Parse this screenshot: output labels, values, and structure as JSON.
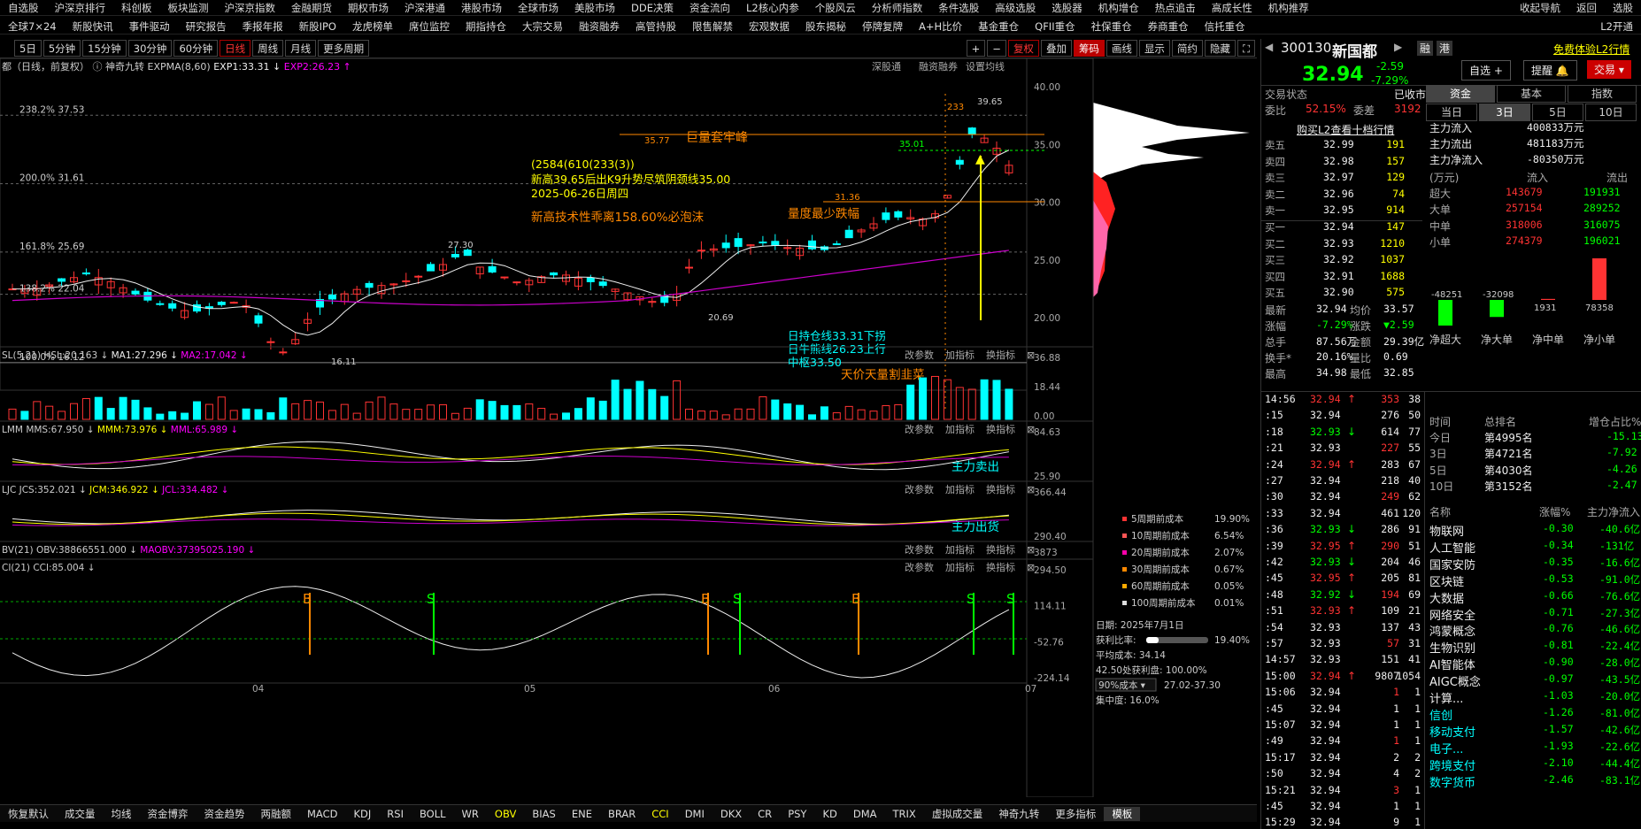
{
  "menu1": [
    "自选股",
    "沪深京排行",
    "科创板",
    "板块监测",
    "沪深京指数",
    "金融期货",
    "期权市场",
    "沪深港通",
    "港股市场",
    "全球市场",
    "美股市场",
    "DDE决策",
    "资金流向",
    "L2核心内参",
    "个股风云",
    "分析师指数",
    "条件选股",
    "高级选股",
    "选股器",
    "机构增仓",
    "热点追击",
    "高成长性",
    "机构推荐"
  ],
  "menu1_right": [
    "收起导航",
    "返回",
    "选股"
  ],
  "menu2": [
    "全球7×24",
    "新股快讯",
    "事件驱动",
    "研究报告",
    "季报年报",
    "新股IPO",
    "龙虎榜单",
    "席位监控",
    "期指持仓",
    "大宗交易",
    "融资融券",
    "高管持股",
    "限售解禁",
    "宏观数据",
    "股东揭秘",
    "停牌复牌",
    "A+H比价",
    "基金重仓",
    "QFII重仓",
    "社保重仓",
    "券商重仓",
    "信托重仓"
  ],
  "menu2_right": "L2开通",
  "toolbar": {
    "periods": [
      "5日",
      "5分钟",
      "15分钟",
      "30分钟",
      "60分钟",
      "日线",
      "周线",
      "月线",
      "更多周期"
    ],
    "selected": "日线",
    "right": [
      "复权",
      "叠加",
      "筹码",
      "画线",
      "显示",
      "简约",
      "隐藏"
    ]
  },
  "chart_header": {
    "name": "都（日线，前复权）",
    "indicator": "神奇九转",
    "expma": "EXPMA(8,60)",
    "exp1": "EXP1:33.31",
    "exp2": "EXP2:26.23",
    "links": [
      "深股通",
      "融资融券",
      "设置均线"
    ]
  },
  "price_axis": [
    "40.00",
    "35.00",
    "30.00",
    "25.00",
    "20.00"
  ],
  "fib_labels": [
    "238.2% 37.53",
    "200.0% 31.61",
    "161.8% 25.69",
    "138.2% 22.04",
    "100.0% 16.12"
  ],
  "annotations": {
    "peak": "39.65",
    "h233": "233",
    "l35_77": "35.77",
    "l35_01": "35.01",
    "l31_36": "31.36",
    "l27_30": "27.30",
    "l16_11": "16.11",
    "l20_69": "20.69",
    "title1": "巨量套牢峰",
    "block1": "(2584(610(233(3))",
    "block2": "新高39.65后出K9升势尽筑阴颈线35.00",
    "block3": "2025-06-26日周四",
    "block4": "新高技术性乖离158.60%必泡沫",
    "block5": "量度最少跌幅",
    "hold1": "日持仓线33.31下拐",
    "hold2": "日牛熊线26.23上行",
    "hold3": "中枢33.50"
  },
  "panels": [
    {
      "title": "SL(5,21)",
      "items": [
        {
          "t": "HSL:20.163",
          "c": "#ccc"
        },
        {
          "t": "MA1:27.296",
          "c": "#eee"
        },
        {
          "t": "MA2:17.042",
          "c": "#f0f"
        }
      ],
      "axis": [
        "36.88",
        "18.44",
        "0.00"
      ],
      "note": "天价天量割韭菜"
    },
    {
      "title": "LMM",
      "items": [
        {
          "t": "MMS:67.950",
          "c": "#ccc"
        },
        {
          "t": "MMM:73.976",
          "c": "#ff0"
        },
        {
          "t": "MML:65.989",
          "c": "#f0f"
        }
      ],
      "axis": [
        "84.63",
        "25.90"
      ],
      "note": "主力卖出"
    },
    {
      "title": "LJC",
      "items": [
        {
          "t": "JCS:352.021",
          "c": "#ccc"
        },
        {
          "t": "JCM:346.922",
          "c": "#ff0"
        },
        {
          "t": "JCL:334.482",
          "c": "#f0f"
        }
      ],
      "axis": [
        "366.44",
        "290.40"
      ],
      "note": "主力出货"
    },
    {
      "title": "BV(21)",
      "items": [
        {
          "t": "OBV:38866551.000",
          "c": "#ccc"
        },
        {
          "t": "MAOBV:37395025.190",
          "c": "#f0f"
        }
      ],
      "axis": [
        "3873"
      ],
      "note": ""
    },
    {
      "title": "CI(21)",
      "items": [
        {
          "t": "CCI:85.004",
          "c": "#ccc"
        }
      ],
      "axis": [
        "294.50",
        "114.11",
        "-52.76",
        "-224.14"
      ],
      "note": ""
    }
  ],
  "panel_btns": [
    "改参数",
    "加指标",
    "换指标"
  ],
  "x_labels": [
    "04",
    "05",
    "06",
    "07"
  ],
  "cost_legend": [
    {
      "label": "5周期前成本",
      "val": "19.90%",
      "c": "#f33"
    },
    {
      "label": "10周期前成本",
      "val": "6.54%",
      "c": "#f55"
    },
    {
      "label": "20周期前成本",
      "val": "2.07%",
      "c": "#f0a"
    },
    {
      "label": "30周期前成本",
      "val": "0.67%",
      "c": "#f80"
    },
    {
      "label": "60周期前成本",
      "val": "0.05%",
      "c": "#fa0"
    },
    {
      "label": "100周期前成本",
      "val": "0.01%",
      "c": "#ddd"
    }
  ],
  "cost_info": {
    "date": "日期: 2025年7月1日",
    "profit_label": "获利比率:",
    "profit": "19.40%",
    "avg": "平均成本: 34.14",
    "profit2": "42.50处获利盘: 100.00%",
    "cost90": "90%成本",
    "range": "27.02-37.30",
    "conc": "集中度: 16.0%"
  },
  "bottom_tabs": [
    "恢复默认",
    "成交量",
    "均线",
    "资金博弈",
    "资金趋势",
    "两融额",
    "MACD",
    "KDJ",
    "RSI",
    "BOLL",
    "WR",
    "OBV",
    "BIAS",
    "ENE",
    "BRAR",
    "CCI",
    "DMI",
    "DKX",
    "CR",
    "PSY",
    "KD",
    "DMA",
    "TRIX",
    "虚拟成交量",
    "神奇九转",
    "更多指标",
    "模板"
  ],
  "bottom_tabs_selected": [
    "OBV",
    "CCI"
  ],
  "stock": {
    "code": "300130",
    "name": "新国都",
    "btn1": "融",
    "btn2": "港",
    "ad": "免费体验L2行情",
    "price": "32.94",
    "chg": "-2.59",
    "pct": "-7.29%",
    "b_self": "自选",
    "b_alert": "提醒",
    "b_trade": "交易"
  },
  "status": {
    "label": "交易状态",
    "val": "已收市",
    "wb_label": "委比",
    "wb": "52.15%",
    "wc_label": "委差",
    "wc": "3192"
  },
  "tabs_top": [
    "资金",
    "基本",
    "指数"
  ],
  "tabs_period": [
    "当日",
    "3日",
    "5日",
    "10日"
  ],
  "l2_link": "购买L2查看十档行情",
  "asks": [
    [
      "卖五",
      "32.99",
      "191"
    ],
    [
      "卖四",
      "32.98",
      "157"
    ],
    [
      "卖三",
      "32.97",
      "129"
    ],
    [
      "卖二",
      "32.96",
      "74"
    ],
    [
      "卖一",
      "32.95",
      "914"
    ]
  ],
  "bids": [
    [
      "买一",
      "32.94",
      "147"
    ],
    [
      "买二",
      "32.93",
      "1210"
    ],
    [
      "买三",
      "32.92",
      "1037"
    ],
    [
      "买四",
      "32.91",
      "1688"
    ],
    [
      "买五",
      "32.90",
      "575"
    ]
  ],
  "stats": [
    [
      "最新",
      "32.94",
      "均价",
      "33.57"
    ],
    [
      "涨幅",
      "-7.29%",
      "涨跌",
      "▼2.59"
    ],
    [
      "总手",
      "87.56万",
      "金额",
      "29.39亿"
    ],
    [
      "换手*",
      "20.16%",
      "量比",
      "0.69"
    ],
    [
      "最高",
      "34.98",
      "最低",
      "32.85"
    ]
  ],
  "flow": [
    [
      "主力流入",
      "400833万元"
    ],
    [
      "主力流出",
      "481183万元"
    ],
    [
      "主力净流入",
      "-80350万元"
    ]
  ],
  "flow_table": {
    "head": [
      "(万元)",
      "流入",
      "流出"
    ],
    "rows": [
      [
        "超大",
        "143679",
        "191931"
      ],
      [
        "大单",
        "257154",
        "289252"
      ],
      [
        "中单",
        "318006",
        "316075"
      ],
      [
        "小单",
        "274379",
        "196021"
      ]
    ]
  },
  "flow_bars": [
    {
      "label": "超大",
      "v": -48251
    },
    {
      "label": "大单",
      "v": -32098
    },
    {
      "label": "中单",
      "v": 1931
    },
    {
      "label": "小单",
      "v": 78358
    }
  ],
  "flow_bar_labels": [
    "-48251",
    "-32098",
    "1931",
    "78358"
  ],
  "flow_bar_cats": [
    "净超大",
    "净大单",
    "净中单",
    "净小单"
  ],
  "ticks": [
    [
      "14:56",
      "32.94",
      "↑",
      "353",
      "38"
    ],
    [
      ":15",
      "32.94",
      "",
      "276",
      "50"
    ],
    [
      ":18",
      "32.93",
      "↓",
      "614",
      "77"
    ],
    [
      ":21",
      "32.93",
      "",
      "227",
      "55"
    ],
    [
      ":24",
      "32.94",
      "↑",
      "283",
      "67"
    ],
    [
      ":27",
      "32.94",
      "",
      "218",
      "40"
    ],
    [
      ":30",
      "32.94",
      "",
      "249",
      "62"
    ],
    [
      ":33",
      "32.94",
      "",
      "461",
      "120"
    ],
    [
      ":36",
      "32.93",
      "↓",
      "286",
      "91"
    ],
    [
      ":39",
      "32.95",
      "↑",
      "290",
      "51"
    ],
    [
      ":42",
      "32.93",
      "↓",
      "204",
      "46"
    ],
    [
      ":45",
      "32.95",
      "↑",
      "205",
      "81"
    ],
    [
      ":48",
      "32.92",
      "↓",
      "194",
      "69"
    ],
    [
      ":51",
      "32.93",
      "↑",
      "109",
      "21"
    ],
    [
      ":54",
      "32.93",
      "",
      "137",
      "43"
    ],
    [
      ":57",
      "32.93",
      "",
      "57",
      "31"
    ],
    [
      "14:57",
      "32.93",
      "",
      "151",
      "41"
    ],
    [
      "15:00",
      "32.94",
      "↑",
      "9807",
      "1054"
    ],
    [
      "15:06",
      "32.94",
      "",
      "1",
      "1"
    ],
    [
      ":45",
      "32.94",
      "",
      "1",
      "1"
    ],
    [
      "15:07",
      "32.94",
      "",
      "1",
      "1"
    ],
    [
      ":49",
      "32.94",
      "",
      "1",
      "1"
    ],
    [
      "15:17",
      "32.94",
      "",
      "2",
      "2"
    ],
    [
      ":50",
      "32.94",
      "",
      "4",
      "2"
    ],
    [
      "15:21",
      "32.94",
      "",
      "3",
      "1"
    ],
    [
      ":45",
      "32.94",
      "",
      "1",
      "1"
    ],
    [
      "15:29",
      "32.94",
      "",
      "9",
      "1"
    ]
  ],
  "rank": {
    "head": [
      "时间",
      "总排名",
      "增仓占比%"
    ],
    "rows": [
      [
        "今日",
        "第4995名",
        "-15.13"
      ],
      [
        "3日",
        "第4721名",
        "-7.92"
      ],
      [
        "5日",
        "第4030名",
        "-4.26"
      ],
      [
        "10日",
        "第3152名",
        "-2.47"
      ]
    ]
  },
  "sectors": {
    "head": [
      "名称",
      "涨幅%",
      "主力净流入"
    ],
    "rows": [
      [
        "物联网",
        "-0.30",
        "-40.6亿"
      ],
      [
        "人工智能",
        "-0.34",
        "-131亿"
      ],
      [
        "国家安防",
        "-0.35",
        "-16.6亿"
      ],
      [
        "区块链",
        "-0.53",
        "-91.0亿"
      ],
      [
        "大数据",
        "-0.66",
        "-76.6亿"
      ],
      [
        "网络安全",
        "-0.71",
        "-27.3亿"
      ],
      [
        "鸿蒙概念",
        "-0.76",
        "-46.6亿"
      ],
      [
        "生物识别",
        "-0.81",
        "-22.4亿"
      ],
      [
        "AI智能体",
        "-0.90",
        "-28.0亿"
      ],
      [
        "AIGC概念",
        "-0.97",
        "-43.5亿"
      ],
      [
        "计算...",
        "-1.03",
        "-20.0亿"
      ],
      [
        "信创",
        "-1.26",
        "-81.0亿"
      ],
      [
        "移动支付",
        "-1.57",
        "-42.6亿"
      ],
      [
        "电子...",
        "-1.93",
        "-22.6亿"
      ],
      [
        "跨境支付",
        "-2.10",
        "-44.4亿"
      ],
      [
        "数字货币",
        "-2.46",
        "-83.1亿"
      ]
    ]
  },
  "colors": {
    "up": "#ff3333",
    "down": "#00ff00",
    "cyan": "#00ffff",
    "accent": "#e8c040"
  }
}
